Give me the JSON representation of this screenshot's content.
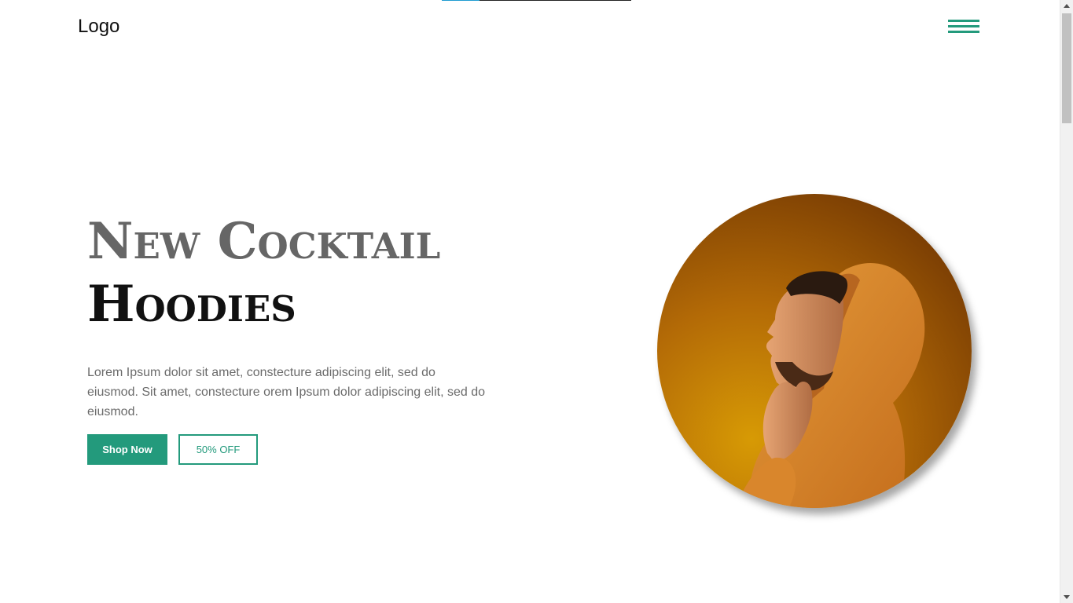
{
  "header": {
    "logo": "Logo",
    "menu_icon": "hamburger-menu-icon",
    "accent_color": "#239a7c"
  },
  "scroll_progress": 0.2,
  "hero": {
    "title_line1": "New Cocktail",
    "title_line2": "Hoodies",
    "description": "Lorem Ipsum dolor sit amet, constecture adipiscing elit, sed do eiusmod. Sit amet, constecture orem Ipsum dolor adipiscing elit, sed do eiusmod.",
    "primary_button": "Shop Now",
    "secondary_button": "50% OFF",
    "image": "person-in-orange-hoodie-photo"
  },
  "scrollbar": {
    "position": 0
  }
}
